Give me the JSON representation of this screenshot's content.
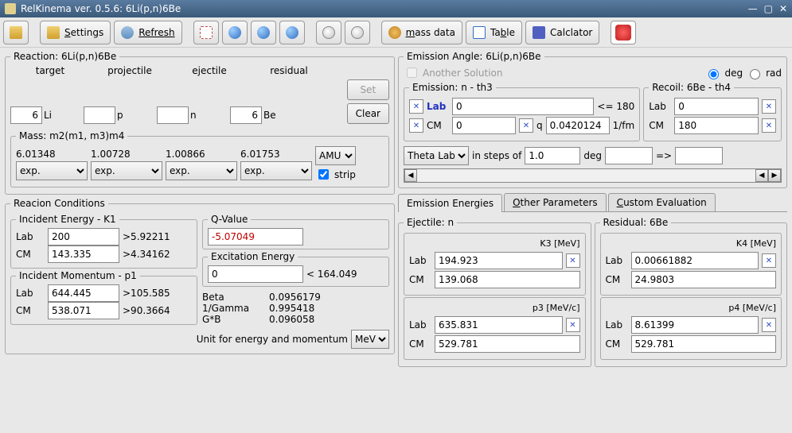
{
  "window": {
    "title": "RelKinema ver. 0.5.6: 6Li(p,n)6Be"
  },
  "toolbar": {
    "settings": "Settings",
    "refresh": "Refresh",
    "massdata": "mass data",
    "table": "Table",
    "calculator": "Calclator"
  },
  "reaction": {
    "legend": "Reaction: 6Li(p,n)6Be",
    "hdr_target": "target",
    "hdr_projectile": "projectile",
    "hdr_ejectile": "ejectile",
    "hdr_residual": "residual",
    "target_a": "6",
    "target_sym": "Li",
    "projectile_a": "",
    "projectile_sym": "p",
    "ejectile_a": "",
    "ejectile_sym": "n",
    "residual_a": "6",
    "residual_sym": "Be",
    "set": "Set",
    "clear": "Clear"
  },
  "mass": {
    "legend": "Mass: m2(m1, m3)m4",
    "m1": "6.01348",
    "m2": "1.00728",
    "m3": "1.00866",
    "m4": "6.01753",
    "src1": "exp.",
    "src2": "exp.",
    "src3": "exp.",
    "src4": "exp.",
    "unit": "AMU",
    "strip": "strip"
  },
  "conditions": {
    "legend": "Reacion Conditions",
    "incE_legend": "Incident Energy - K1",
    "lab": "Lab",
    "cm": "CM",
    "e_lab": "200",
    "e_lab_lim": ">5.92211",
    "e_cm": "143.335",
    "e_cm_lim": ">4.34162",
    "incP_legend": "Incident Momentum - p1",
    "p_lab": "644.445",
    "p_lab_lim": ">105.585",
    "p_cm": "538.071",
    "p_cm_lim": ">90.3664",
    "qvalue_legend": "Q-Value",
    "qvalue": "-5.07049",
    "excE_legend": "Excitation Energy",
    "excE": "0",
    "excE_lim": "< 164.049",
    "beta_l": "Beta",
    "beta": "0.0956179",
    "inv_gamma_l": "1/Gamma",
    "inv_gamma": "0.995418",
    "gb_l": "G*B",
    "gb": "0.096058",
    "unit_label": "Unit for energy and momentum",
    "unit": "MeV"
  },
  "emission": {
    "legend": "Emission Angle: 6Li(p,n)6Be",
    "another": "Another Solution",
    "deg": "deg",
    "rad": "rad",
    "em_legend": "Emission: n - th3",
    "lab_l": "Lab",
    "cm_l": "CM",
    "em_lab": "0",
    "em_lab_lim": "<= 180",
    "em_cm": "0",
    "q_l": "q",
    "q_val": "0.0420124",
    "q_unit": "1/fm",
    "rec_legend": "Recoil: 6Be - th4",
    "rec_lab": "0",
    "rec_cm": "180",
    "theta_sel": "Theta Lab",
    "steps_l": "in steps of",
    "steps": "1.0",
    "steps_unit": "deg",
    "arrow": "=>"
  },
  "tabs": {
    "t1": "Emission Energies",
    "t2": "Other Parameters",
    "t3": "Custom Evaluation"
  },
  "ejectile": {
    "legend": "Ejectile: n",
    "k_title": "K3 [MeV]",
    "k_lab": "194.923",
    "k_cm": "139.068",
    "p_title": "p3 [MeV/c]",
    "p_lab": "635.831",
    "p_cm": "529.781"
  },
  "residual": {
    "legend": "Residual: 6Be",
    "k_title": "K4 [MeV]",
    "k_lab": "0.00661882",
    "k_cm": "24.9803",
    "p_title": "p4 [MeV/c]",
    "p_lab": "8.61399",
    "p_cm": "529.781"
  },
  "common": {
    "lab": "Lab",
    "cm": "CM"
  }
}
